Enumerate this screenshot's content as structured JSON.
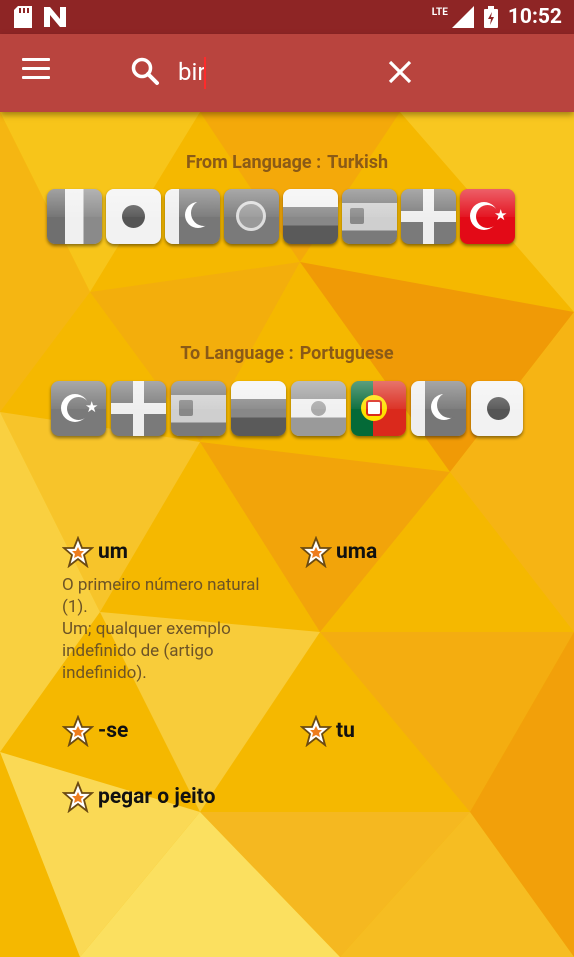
{
  "status_bar": {
    "time": "10:52",
    "network": "LTE",
    "left_icons": [
      "sd-card-icon",
      "n-logo-icon"
    ]
  },
  "app_bar": {
    "search_query": "bir",
    "menu_icon": "menu-icon",
    "search_icon": "search-icon",
    "clear_icon": "close-icon"
  },
  "from_language": {
    "label": "From Language :",
    "value": "Turkish",
    "flags": [
      "Italy",
      "Japan",
      "Pakistan",
      "Portugal",
      "Russia",
      "Spain",
      "England",
      "Turkey"
    ],
    "selected": "Turkey"
  },
  "to_language": {
    "label": "To Language :",
    "value": "Portuguese",
    "flags": [
      "Turkey",
      "England",
      "Spain",
      "Russia",
      "Argentina",
      "Portugal",
      "Pakistan",
      "Japan"
    ],
    "selected": "Portugal"
  },
  "results": [
    {
      "word": "um",
      "definition": "O primeiro número natural (1).\nUm; qualquer exemplo indefinido de (artigo indefinido)."
    },
    {
      "word": "uma",
      "definition": ""
    },
    {
      "word": "-se",
      "definition": ""
    },
    {
      "word": "tu",
      "definition": ""
    },
    {
      "word": "pegar o jeito",
      "definition": ""
    }
  ],
  "colors": {
    "status_bar": "#8e2525",
    "app_bar": "#b9443e",
    "label_text": "#8a5a17",
    "background": "#f5b800"
  }
}
